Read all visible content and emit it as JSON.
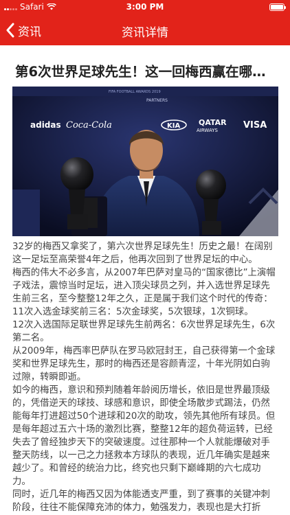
{
  "status_bar": {
    "carrier": "Safari",
    "time": "3:00 PM",
    "battery_level": 1.0
  },
  "nav": {
    "back_label": "资讯",
    "title": "资讯详情"
  },
  "article": {
    "title": "第6次世界足球先生！这一回梅西赢在哪…",
    "paragraphs": [
      "32岁的梅西又拿奖了，第六次世界足球先生！历史之最！在阔别这一足坛至高荣誉4年之后，他再次回到了世界足坛的中心。",
      "梅西的伟大不必多言，从2007年巴萨对皇马的“国家德比”上演帽子戏法，震惊当时足坛，进入顶尖球员之列，并入选世界足球先生前三名，至今整整12年之久，正是属于我们这个时代的传奇：",
      "11次入选金球奖前三名：5次金球奖，5次银球，1次铜球。",
      "12次入选国际足联世界足球先生前两名：6次世界足球先生，6次第二名。",
      "从2009年，梅西率巴萨队在罗马欧冠封王，自己获得第一个金球奖和世界足球先生，那时的梅西还是容颜青涩，十年光阴如白驹过隙，转瞬即逝。",
      "如今的梅西，意识和预判随着年龄阅历增长，依旧是世界最顶级的，凭借逆天的球技、球感和意识，即使全场散步式踢法，仍然能每年打进超过50个进球和20次的助攻，领先其他所有球员。但是每年超过五六十场的激烈比赛，整整12年的超负荷运转，已经失去了曾经独步天下的突破速度。过往那种一个人就能爆破对手整天防线，以一己之力拯救本方球队的表现，近几年确实是越来越少了。和曾经的统治力比，终究也只剩下巅峰期的六七成功力。",
      "同时，近几年的梅西又因为体能透支严重，到了赛事的关键冲刺阶段，往往不能保障充沛的体力，勉强发力，表现也是大打折扣。"
    ]
  },
  "photo": {
    "sponsors": [
      "adidas",
      "Coca-Cola",
      "KIA",
      "QATAR",
      "AIRWAYS",
      "VISA",
      "FIFA FOOTBALL AWARDS 2019",
      "PARTNERS"
    ],
    "colors": {
      "backdrop": "#12163a",
      "suit": "#1b2a5a",
      "trophy": "#1a1a1c",
      "skin": "#c68c63",
      "hair": "#4a3525"
    }
  },
  "theme": {
    "brand_red": "#e2231a"
  }
}
